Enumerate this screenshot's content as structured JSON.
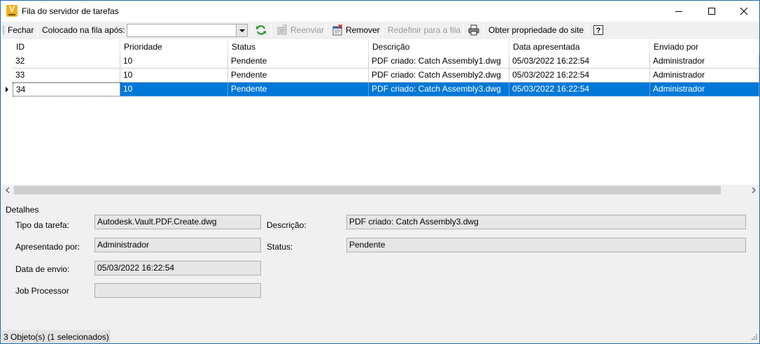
{
  "window": {
    "title": "Fila do servidor de tarefas"
  },
  "toolbar": {
    "close_label": "Fechar",
    "queued_after_label": "Colocado na fila após:",
    "queued_after_value": "",
    "resend_label": "Reenviar",
    "remove_label": "Remover",
    "reset_label": "Redefinir para a fila",
    "site_property_label": "Obter propriedade do site",
    "help_icon_glyph": "?"
  },
  "grid": {
    "columns": [
      "ID",
      "Prioridade",
      "Status",
      "Descrição",
      "Data apresentada",
      "Enviado por"
    ],
    "rows": [
      {
        "id": "32",
        "priority": "10",
        "status": "Pendente",
        "description": "PDF criado: Catch Assembly1.dwg",
        "date": "05/03/2022 16:22:54",
        "sent_by": "Administrador",
        "selected": false
      },
      {
        "id": "33",
        "priority": "10",
        "status": "Pendente",
        "description": "PDF criado: Catch Assembly2.dwg",
        "date": "05/03/2022 16:22:54",
        "sent_by": "Administrador",
        "selected": false
      },
      {
        "id": "34",
        "priority": "10",
        "status": "Pendente",
        "description": "PDF criado: Catch Assembly3.dwg",
        "date": "05/03/2022 16:22:54",
        "sent_by": "Administrador",
        "selected": true
      }
    ]
  },
  "details": {
    "group_label": "Detalhes",
    "task_type_label": "Tipo da tarefa:",
    "task_type_value": "Autodesk.Vault.PDF.Create.dwg",
    "submitted_by_label": "Apresentado por:",
    "submitted_by_value": "Administrador",
    "send_date_label": "Data de envio:",
    "send_date_value": "05/03/2022 16:22:54",
    "job_processor_label": "Job Processor",
    "job_processor_value": "",
    "description_label": "Descrição:",
    "description_value": "PDF criado: Catch Assembly3.dwg",
    "status_label": "Status:",
    "status_value": "Pendente"
  },
  "statusbar": {
    "text": "3 Objeto(s) (1 selecionados)"
  },
  "colors": {
    "selection": "#0078d7",
    "window_border": "#1c6bb8"
  }
}
